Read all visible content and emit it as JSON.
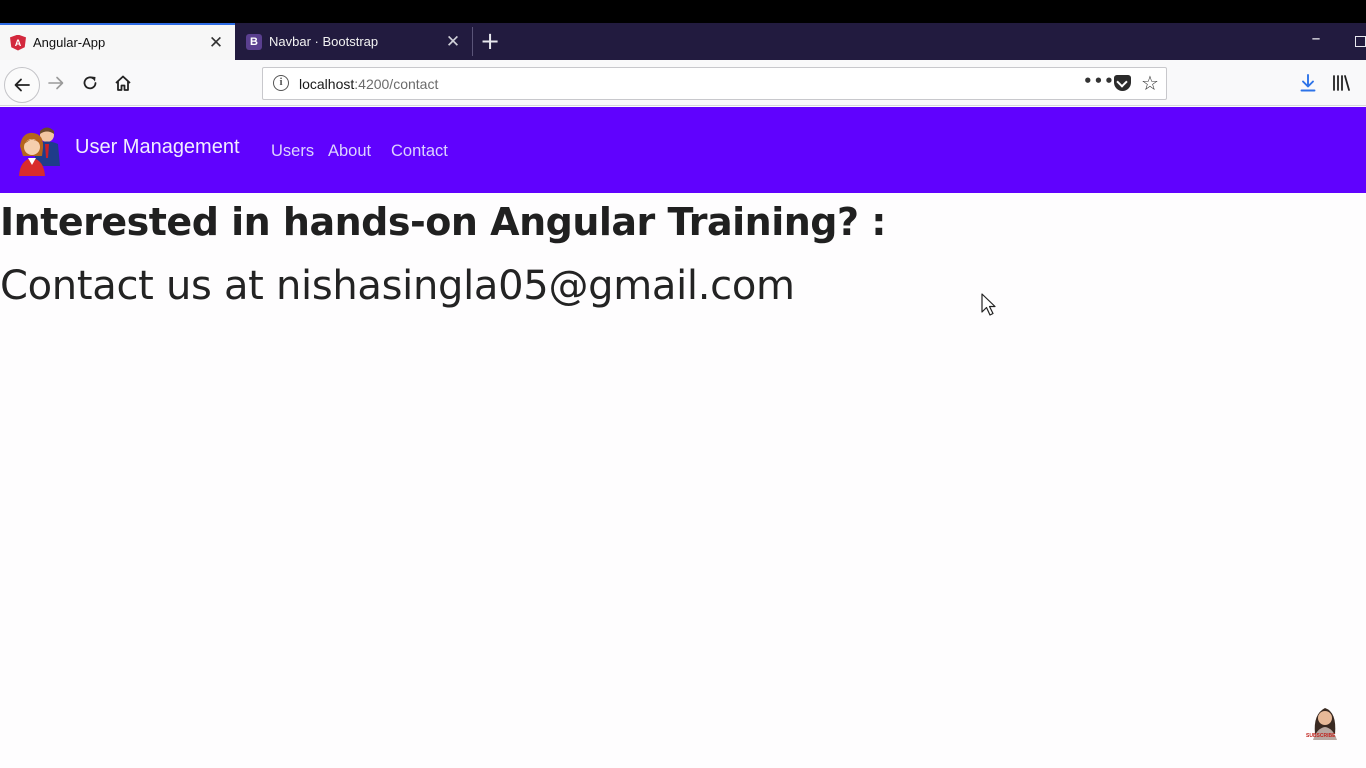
{
  "browser": {
    "tabs": [
      {
        "title": "Angular-App",
        "favicon": "angular-icon",
        "active": true
      },
      {
        "title": "Navbar · Bootstrap",
        "favicon": "bootstrap-icon",
        "favicon_letter": "B",
        "active": false
      }
    ],
    "tab_close_glyph": "✕",
    "new_tab_glyph": "+",
    "url": {
      "host": "localhost",
      "path": ":4200/contact"
    },
    "icons": {
      "back": "back-arrow-icon",
      "forward": "forward-arrow-icon",
      "reload": "reload-icon",
      "home": "home-icon",
      "site_info": "info-icon",
      "more": "more-icon",
      "pocket": "pocket-icon",
      "bookmark": "star-icon",
      "downloads": "download-icon",
      "library": "library-icon"
    }
  },
  "app_navbar": {
    "background": "#6002fe",
    "brand": "User Management",
    "links": [
      "Users",
      "About",
      "Contact"
    ]
  },
  "content": {
    "heading": "Interested in hands-on Angular Training? :",
    "contact": "Contact us at nishasingla05@gmail.com"
  },
  "watermark": {
    "text": "SUBSCRIBE"
  }
}
